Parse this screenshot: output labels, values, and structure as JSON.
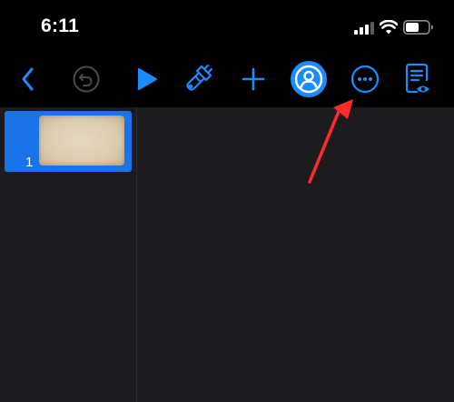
{
  "status_bar": {
    "time": "6:11"
  },
  "toolbar": {
    "buttons": [
      {
        "name": "back",
        "icon": "chevron-left-icon"
      },
      {
        "name": "undo",
        "icon": "undo-icon"
      },
      {
        "name": "play",
        "icon": "play-icon"
      },
      {
        "name": "format",
        "icon": "paintbrush-icon"
      },
      {
        "name": "add",
        "icon": "plus-icon"
      },
      {
        "name": "collaborate",
        "icon": "person-circle-icon"
      },
      {
        "name": "more",
        "icon": "ellipsis-circle-icon"
      },
      {
        "name": "view",
        "icon": "document-view-icon"
      }
    ]
  },
  "navigator": {
    "slides": [
      {
        "number": "1",
        "selected": true
      }
    ]
  },
  "colors": {
    "accent": "#1a8cff",
    "selection": "#1a73e8",
    "background": "#1c1c1e",
    "toolbar_background": "#000000",
    "annotation": "#ff2a2a"
  }
}
